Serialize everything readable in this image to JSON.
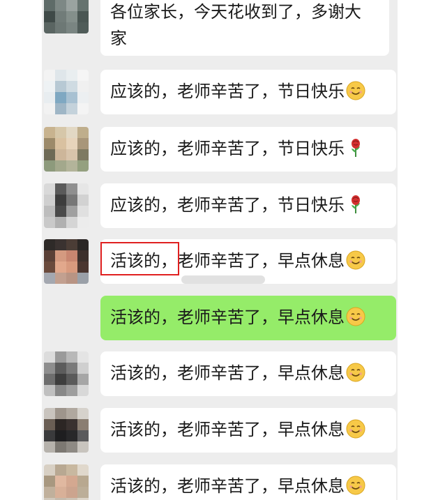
{
  "messages": [
    {
      "text": "各位家长，今天花收到了，多谢大家",
      "line1": "各位家长，今天花收到了，多谢大",
      "line2": "家",
      "from": "teacher",
      "emoji": ""
    },
    {
      "text": "应该的，老师辛苦了，节日快乐",
      "from": "parent",
      "emoji": "smile-emoji"
    },
    {
      "text": "应该的，老师辛苦了，节日快乐",
      "from": "parent",
      "emoji": "rose-emoji"
    },
    {
      "text": "应该的，老师辛苦了，节日快乐",
      "from": "parent",
      "emoji": "rose-emoji"
    },
    {
      "text": "活该的，老师辛苦了，早点休息",
      "from": "parent",
      "emoji": "smile-emoji",
      "highlighted": "活该的，"
    },
    {
      "text": "活该的，老师辛苦了，早点休息",
      "from": "self",
      "emoji": "smile-emoji"
    },
    {
      "text": "活该的，老师辛苦了，早点休息",
      "from": "parent",
      "emoji": "smile-emoji"
    },
    {
      "text": "活该的，老师辛苦了，早点休息",
      "from": "parent",
      "emoji": "smile-emoji"
    },
    {
      "text": "活该的，老师辛苦了，早点休息",
      "from": "parent",
      "emoji": "smile-emoji"
    }
  ],
  "highlight": {
    "text": "活该的，",
    "color": "#e02020"
  },
  "colors": {
    "background": "#ededed",
    "bubble": "#ffffff",
    "self_bubble": "#95ec69"
  }
}
